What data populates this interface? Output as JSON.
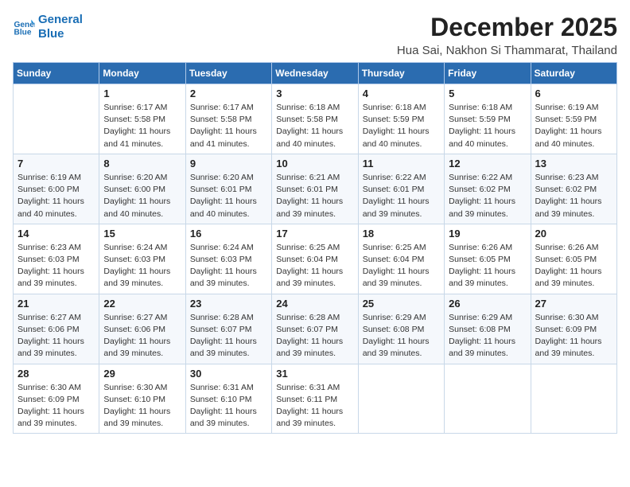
{
  "header": {
    "logo_line1": "General",
    "logo_line2": "Blue",
    "month_year": "December 2025",
    "location": "Hua Sai, Nakhon Si Thammarat, Thailand"
  },
  "weekdays": [
    "Sunday",
    "Monday",
    "Tuesday",
    "Wednesday",
    "Thursday",
    "Friday",
    "Saturday"
  ],
  "weeks": [
    [
      {
        "day": "",
        "sunrise": "",
        "sunset": "",
        "daylight": ""
      },
      {
        "day": "1",
        "sunrise": "6:17 AM",
        "sunset": "5:58 PM",
        "daylight": "11 hours and 41 minutes."
      },
      {
        "day": "2",
        "sunrise": "6:17 AM",
        "sunset": "5:58 PM",
        "daylight": "11 hours and 41 minutes."
      },
      {
        "day": "3",
        "sunrise": "6:18 AM",
        "sunset": "5:58 PM",
        "daylight": "11 hours and 40 minutes."
      },
      {
        "day": "4",
        "sunrise": "6:18 AM",
        "sunset": "5:59 PM",
        "daylight": "11 hours and 40 minutes."
      },
      {
        "day": "5",
        "sunrise": "6:18 AM",
        "sunset": "5:59 PM",
        "daylight": "11 hours and 40 minutes."
      },
      {
        "day": "6",
        "sunrise": "6:19 AM",
        "sunset": "5:59 PM",
        "daylight": "11 hours and 40 minutes."
      }
    ],
    [
      {
        "day": "7",
        "sunrise": "6:19 AM",
        "sunset": "6:00 PM",
        "daylight": "11 hours and 40 minutes."
      },
      {
        "day": "8",
        "sunrise": "6:20 AM",
        "sunset": "6:00 PM",
        "daylight": "11 hours and 40 minutes."
      },
      {
        "day": "9",
        "sunrise": "6:20 AM",
        "sunset": "6:01 PM",
        "daylight": "11 hours and 40 minutes."
      },
      {
        "day": "10",
        "sunrise": "6:21 AM",
        "sunset": "6:01 PM",
        "daylight": "11 hours and 39 minutes."
      },
      {
        "day": "11",
        "sunrise": "6:22 AM",
        "sunset": "6:01 PM",
        "daylight": "11 hours and 39 minutes."
      },
      {
        "day": "12",
        "sunrise": "6:22 AM",
        "sunset": "6:02 PM",
        "daylight": "11 hours and 39 minutes."
      },
      {
        "day": "13",
        "sunrise": "6:23 AM",
        "sunset": "6:02 PM",
        "daylight": "11 hours and 39 minutes."
      }
    ],
    [
      {
        "day": "14",
        "sunrise": "6:23 AM",
        "sunset": "6:03 PM",
        "daylight": "11 hours and 39 minutes."
      },
      {
        "day": "15",
        "sunrise": "6:24 AM",
        "sunset": "6:03 PM",
        "daylight": "11 hours and 39 minutes."
      },
      {
        "day": "16",
        "sunrise": "6:24 AM",
        "sunset": "6:03 PM",
        "daylight": "11 hours and 39 minutes."
      },
      {
        "day": "17",
        "sunrise": "6:25 AM",
        "sunset": "6:04 PM",
        "daylight": "11 hours and 39 minutes."
      },
      {
        "day": "18",
        "sunrise": "6:25 AM",
        "sunset": "6:04 PM",
        "daylight": "11 hours and 39 minutes."
      },
      {
        "day": "19",
        "sunrise": "6:26 AM",
        "sunset": "6:05 PM",
        "daylight": "11 hours and 39 minutes."
      },
      {
        "day": "20",
        "sunrise": "6:26 AM",
        "sunset": "6:05 PM",
        "daylight": "11 hours and 39 minutes."
      }
    ],
    [
      {
        "day": "21",
        "sunrise": "6:27 AM",
        "sunset": "6:06 PM",
        "daylight": "11 hours and 39 minutes."
      },
      {
        "day": "22",
        "sunrise": "6:27 AM",
        "sunset": "6:06 PM",
        "daylight": "11 hours and 39 minutes."
      },
      {
        "day": "23",
        "sunrise": "6:28 AM",
        "sunset": "6:07 PM",
        "daylight": "11 hours and 39 minutes."
      },
      {
        "day": "24",
        "sunrise": "6:28 AM",
        "sunset": "6:07 PM",
        "daylight": "11 hours and 39 minutes."
      },
      {
        "day": "25",
        "sunrise": "6:29 AM",
        "sunset": "6:08 PM",
        "daylight": "11 hours and 39 minutes."
      },
      {
        "day": "26",
        "sunrise": "6:29 AM",
        "sunset": "6:08 PM",
        "daylight": "11 hours and 39 minutes."
      },
      {
        "day": "27",
        "sunrise": "6:30 AM",
        "sunset": "6:09 PM",
        "daylight": "11 hours and 39 minutes."
      }
    ],
    [
      {
        "day": "28",
        "sunrise": "6:30 AM",
        "sunset": "6:09 PM",
        "daylight": "11 hours and 39 minutes."
      },
      {
        "day": "29",
        "sunrise": "6:30 AM",
        "sunset": "6:10 PM",
        "daylight": "11 hours and 39 minutes."
      },
      {
        "day": "30",
        "sunrise": "6:31 AM",
        "sunset": "6:10 PM",
        "daylight": "11 hours and 39 minutes."
      },
      {
        "day": "31",
        "sunrise": "6:31 AM",
        "sunset": "6:11 PM",
        "daylight": "11 hours and 39 minutes."
      },
      {
        "day": "",
        "sunrise": "",
        "sunset": "",
        "daylight": ""
      },
      {
        "day": "",
        "sunrise": "",
        "sunset": "",
        "daylight": ""
      },
      {
        "day": "",
        "sunrise": "",
        "sunset": "",
        "daylight": ""
      }
    ]
  ],
  "labels": {
    "sunrise_prefix": "Sunrise: ",
    "sunset_prefix": "Sunset: ",
    "daylight_prefix": "Daylight: "
  }
}
